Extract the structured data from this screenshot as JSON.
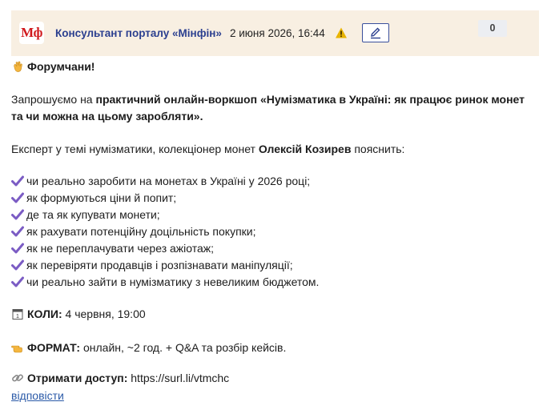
{
  "header": {
    "logo_text": "Мф",
    "author": "Консультант порталу «Мінфін»",
    "date": "2 июня 2026, 16:44",
    "count": "0"
  },
  "post": {
    "greeting": "Форумчани!",
    "invite_prefix": "Запрошуємо на ",
    "invite_bold_1": "практичний онлайн-воркшоп «Нумізматика в Україні: як працює ринок монет",
    "invite_bold_2": "та чи можна на цьому заробляти».",
    "expert_prefix": "Експерт у темі нумізматики, колекціонер монет ",
    "expert_name": "Олексій Козирев",
    "expert_suffix": " пояснить:",
    "items": [
      "чи реально заробити на монетах в Україні у 2026 році;",
      "як формуються ціни й попит;",
      "де та як купувати монети;",
      "як рахувати потенційну доцільність покупки;",
      "як не переплачувати через ажіотаж;",
      "як перевіряти продавців і розпізнавати маніпуляції;",
      "чи реально зайти в нумізматику з невеликим бюджетом."
    ],
    "when_label": "КОЛИ:",
    "when_value": " 4 червня, 19:00",
    "format_label": "ФОРМАТ:",
    "format_value": " онлайн, ~2 год. + Q&A та розбір кейсів.",
    "access_label": "Отримати доступ:",
    "access_url": "https://surl.li/vtmchc"
  },
  "reply_label": "відповісти",
  "colors": {
    "header_bg": "#f8efe2",
    "author": "#2b3f8f",
    "check": "#7b5cc4",
    "link": "#2b5aa8"
  }
}
